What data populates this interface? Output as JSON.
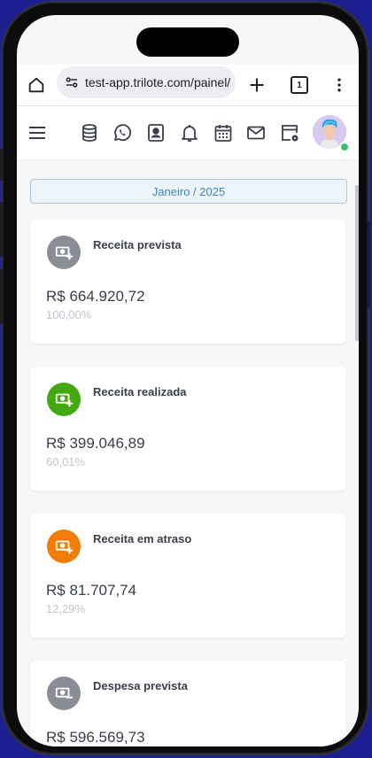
{
  "browser": {
    "url": "test-app.trilote.com/painel/",
    "tab_count": "1"
  },
  "app": {
    "month_label": "Janeiro / 2025"
  },
  "cards": [
    {
      "title": "Receita prevista",
      "value": "R$ 664.920,72",
      "percent": "100,00%",
      "color": "#8a8d93"
    },
    {
      "title": "Receita realizada",
      "value": "R$ 399.046,89",
      "percent": "60,01%",
      "color": "#43a812"
    },
    {
      "title": "Receita em atraso",
      "value": "R$ 81.707,74",
      "percent": "12,29%",
      "color": "#f07d0a"
    },
    {
      "title": "Despesa prevista",
      "value": "R$ 596.569,73",
      "percent": "",
      "color": "#8a8d93"
    }
  ]
}
